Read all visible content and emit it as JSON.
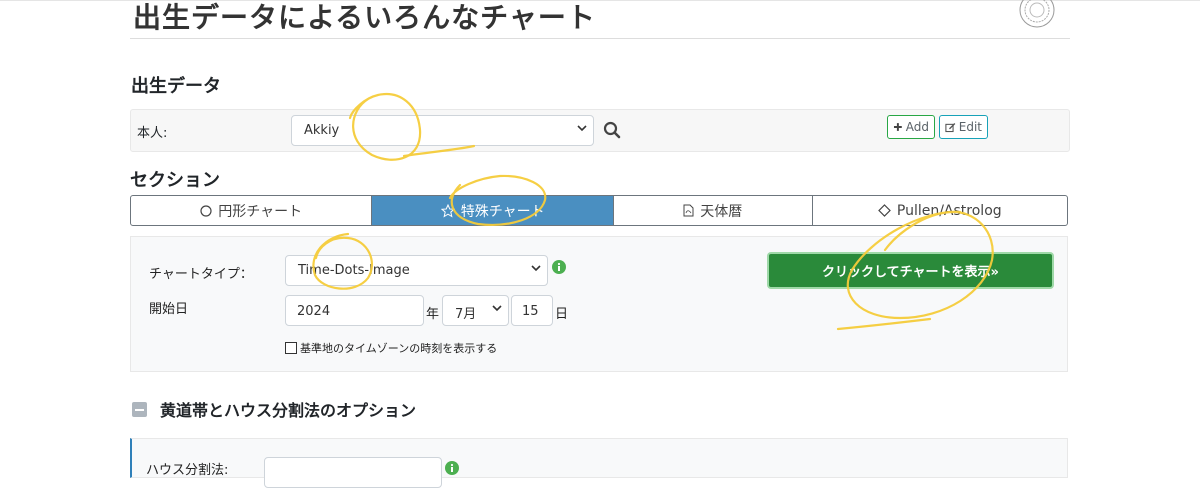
{
  "page": {
    "title": "出生データによるいろんなチャート"
  },
  "birth_data": {
    "heading": "出生データ",
    "person_label": "本人:",
    "person_value": "Akkiy",
    "add_label": "Add",
    "edit_label": "Edit"
  },
  "section": {
    "heading": "セクション",
    "tabs": [
      {
        "label": "円形チャート",
        "icon": "circle-icon"
      },
      {
        "label": "特殊チャート",
        "icon": "star-icon",
        "active": true
      },
      {
        "label": "天体暦",
        "icon": "pdf-file-icon"
      },
      {
        "label": "Pullen/Astrolog",
        "icon": "diamond-icon"
      }
    ]
  },
  "form": {
    "chart_type_label": "チャートタイプ：",
    "chart_type_value": "Time-Dots-Image",
    "start_date_label": "開始日",
    "year_value": "2024",
    "year_suffix": "年",
    "month_value": "7月",
    "day_value": "15",
    "day_suffix": "日",
    "timezone_checkbox_label": "基準地のタイムゾーンの時刻を表示する",
    "show_button_label": "クリックしてチャートを表示»"
  },
  "options": {
    "heading": "黄道帯とハウス分割法のオプション",
    "house_label": "ハウス分割法:"
  },
  "colors": {
    "active_tab": "#4a8fc1",
    "show_button": "#2a8a3a",
    "annotation": "#f5cc3a"
  }
}
